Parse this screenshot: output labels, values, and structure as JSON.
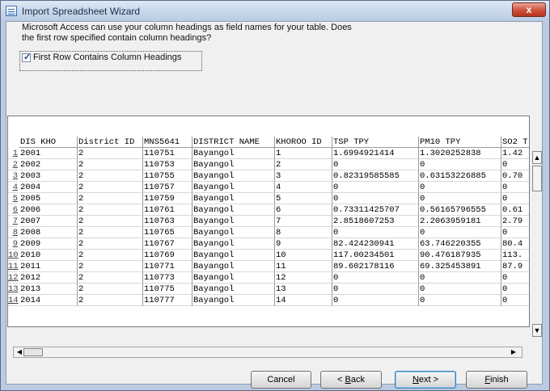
{
  "window": {
    "title": "Import Spreadsheet Wizard",
    "close_glyph": "x"
  },
  "prompt": "Microsoft Access can use your column headings as field names for your table. Does the first row specified contain column headings?",
  "checkbox": {
    "label": "First Row Contains Column Headings",
    "checked": true,
    "mark": "✓"
  },
  "grid": {
    "columns": [
      "DIS KHO",
      "District ID",
      "MNS5641",
      "DISTRICT NAME",
      "KHOROO ID",
      "TSP TPY",
      "PM10 TPY",
      "SO2 T"
    ],
    "rows": [
      {
        "num": "1",
        "cells": [
          "2001",
          "2",
          "110751",
          "Bayangol",
          "1",
          "1.6994921414",
          "1.3020252838",
          "1.42"
        ]
      },
      {
        "num": "2",
        "cells": [
          "2002",
          "2",
          "110753",
          "Bayangol",
          "2",
          "0",
          "0",
          "0"
        ]
      },
      {
        "num": "3",
        "cells": [
          "2003",
          "2",
          "110755",
          "Bayangol",
          "3",
          "0.82319585585",
          "0.63153226885",
          "0.70"
        ]
      },
      {
        "num": "4",
        "cells": [
          "2004",
          "2",
          "110757",
          "Bayangol",
          "4",
          "0",
          "0",
          "0"
        ]
      },
      {
        "num": "5",
        "cells": [
          "2005",
          "2",
          "110759",
          "Bayangol",
          "5",
          "0",
          "0",
          "0"
        ]
      },
      {
        "num": "6",
        "cells": [
          "2006",
          "2",
          "110761",
          "Bayangol",
          "6",
          "0.73311425707",
          "0.56165796555",
          "0.61"
        ]
      },
      {
        "num": "7",
        "cells": [
          "2007",
          "2",
          "110763",
          "Bayangol",
          "7",
          "2.8518607253",
          "2.2063959181",
          "2.79"
        ]
      },
      {
        "num": "8",
        "cells": [
          "2008",
          "2",
          "110765",
          "Bayangol",
          "8",
          "0",
          "0",
          "0"
        ]
      },
      {
        "num": "9",
        "cells": [
          "2009",
          "2",
          "110767",
          "Bayangol",
          "9",
          "82.424230941",
          "63.746220355",
          "80.4"
        ]
      },
      {
        "num": "10",
        "cells": [
          "2010",
          "2",
          "110769",
          "Bayangol",
          "10",
          "117.00234501",
          "90.476187935",
          "113."
        ]
      },
      {
        "num": "11",
        "cells": [
          "2011",
          "2",
          "110771",
          "Bayangol",
          "11",
          "89.602178116",
          "69.325453891",
          "87.9"
        ]
      },
      {
        "num": "12",
        "cells": [
          "2012",
          "2",
          "110773",
          "Bayangol",
          "12",
          "0",
          "0",
          "0"
        ]
      },
      {
        "num": "13",
        "cells": [
          "2013",
          "2",
          "110775",
          "Bayangol",
          "13",
          "0",
          "0",
          "0"
        ]
      },
      {
        "num": "14",
        "cells": [
          "2014",
          "2",
          "110777",
          "Bayangol",
          "14",
          "0",
          "0",
          "0"
        ]
      }
    ]
  },
  "scroll": {
    "up": "▲",
    "down": "▼",
    "left": "◀",
    "right": "▶"
  },
  "buttons": {
    "cancel": "Cancel",
    "back": "< Back",
    "next": "Next >",
    "finish": "Finish"
  }
}
